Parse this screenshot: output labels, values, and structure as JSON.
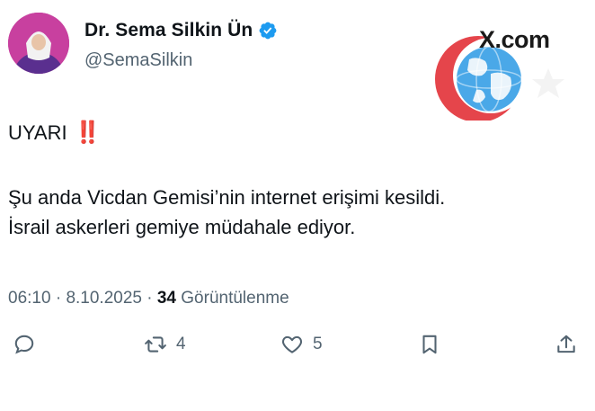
{
  "author": {
    "name": "Dr. Sema Silkin Ün",
    "handle": "@SemaSilkin",
    "verified_color": "#1d9bf0",
    "avatar_icon": "person-avatar"
  },
  "watermark": {
    "text": "X.com",
    "icon": "globe-crescent-star-icon"
  },
  "tweet": {
    "heading": "UYARI",
    "heading_emoji": "‼️",
    "line1": "Şu anda Vicdan Gemisi’nin internet erişimi kesildi.",
    "line2": "İsrail askerleri gemiye müdahale ediyor."
  },
  "meta": {
    "time": "06:10",
    "separator": " · ",
    "date": "8.10.2025",
    "views_count": "34",
    "views_label": "Görüntülenme"
  },
  "actions": {
    "reply_count": "",
    "retweet_count": "4",
    "like_count": "5"
  }
}
